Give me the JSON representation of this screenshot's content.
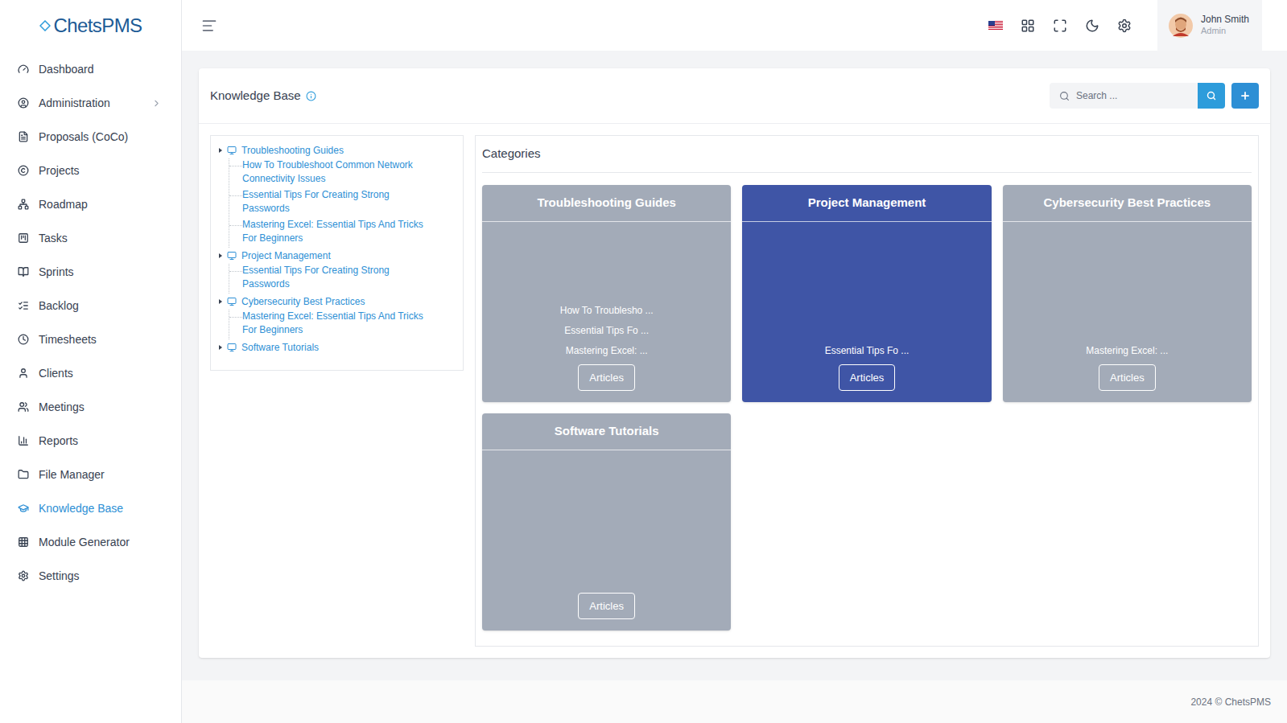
{
  "app": {
    "logo": "ChetsPMS"
  },
  "sidebar": {
    "items": [
      {
        "label": "Dashboard",
        "selected": false,
        "has_submenu": false
      },
      {
        "label": "Administration",
        "selected": false,
        "has_submenu": true
      },
      {
        "label": "Proposals (CoCo)",
        "selected": false,
        "has_submenu": false
      },
      {
        "label": "Projects",
        "selected": false,
        "has_submenu": false
      },
      {
        "label": "Roadmap",
        "selected": false,
        "has_submenu": false
      },
      {
        "label": "Tasks",
        "selected": false,
        "has_submenu": false
      },
      {
        "label": "Sprints",
        "selected": false,
        "has_submenu": false
      },
      {
        "label": "Backlog",
        "selected": false,
        "has_submenu": false
      },
      {
        "label": "Timesheets",
        "selected": false,
        "has_submenu": false
      },
      {
        "label": "Clients",
        "selected": false,
        "has_submenu": false
      },
      {
        "label": "Meetings",
        "selected": false,
        "has_submenu": false
      },
      {
        "label": "Reports",
        "selected": false,
        "has_submenu": false
      },
      {
        "label": "File Manager",
        "selected": false,
        "has_submenu": false
      },
      {
        "label": "Knowledge Base",
        "selected": true,
        "has_submenu": false
      },
      {
        "label": "Module Generator",
        "selected": false,
        "has_submenu": false
      },
      {
        "label": "Settings",
        "selected": false,
        "has_submenu": false
      }
    ]
  },
  "header": {
    "user": {
      "name": "John Smith",
      "role": "Admin"
    }
  },
  "knowledge_base": {
    "title": "Knowledge Base",
    "search": {
      "placeholder": "Search ..."
    },
    "tree": [
      {
        "label": "Troubleshooting Guides",
        "children": [
          "How To Troubleshoot Common Network Connectivity Issues",
          "Essential Tips For Creating Strong Passwords",
          "Mastering Excel: Essential Tips And Tricks For Beginners"
        ]
      },
      {
        "label": "Project Management",
        "children": [
          "Essential Tips For Creating Strong Passwords"
        ]
      },
      {
        "label": "Cybersecurity Best Practices",
        "children": [
          "Mastering Excel: Essential Tips And Tricks For Beginners"
        ]
      },
      {
        "label": "Software Tutorials",
        "children": []
      }
    ],
    "categories": {
      "title": "Categories",
      "cards": [
        {
          "title": "Troubleshooting Guides",
          "highlighted": false,
          "articles": [
            "How To Troublesho ...",
            "Essential Tips Fo ...",
            "Mastering Excel: ..."
          ],
          "button": "Articles"
        },
        {
          "title": "Project Management",
          "highlighted": true,
          "articles": [
            "Essential Tips Fo ..."
          ],
          "button": "Articles"
        },
        {
          "title": "Cybersecurity Best Practices",
          "highlighted": false,
          "articles": [
            "Mastering Excel: ..."
          ],
          "button": "Articles"
        },
        {
          "title": "Software Tutorials",
          "highlighted": false,
          "articles": [],
          "button": "Articles"
        }
      ]
    }
  },
  "footer": "2024 © ChetsPMS"
}
